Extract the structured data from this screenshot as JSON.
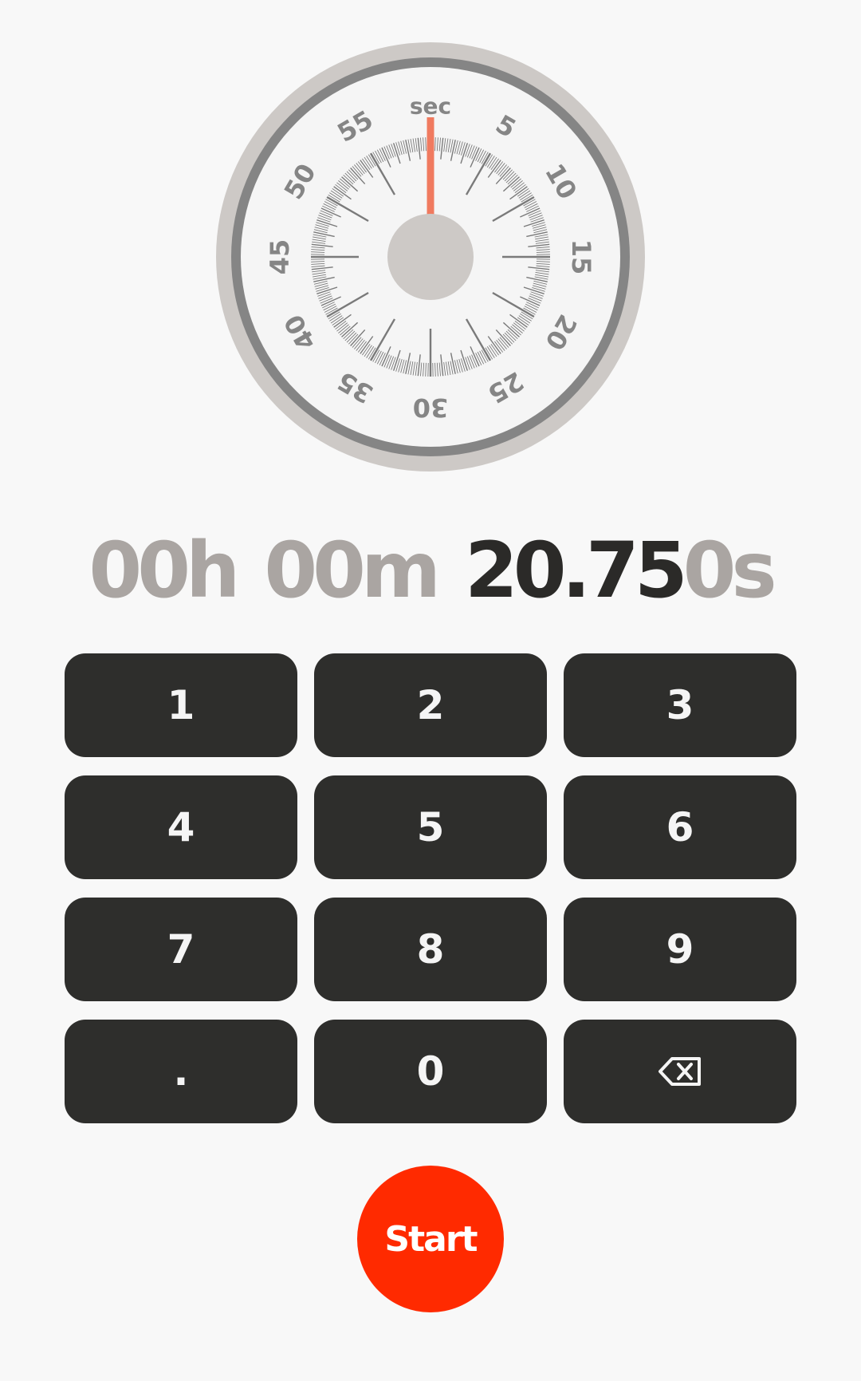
{
  "dial": {
    "unit_label": "sec",
    "numbers": [
      "5",
      "10",
      "15",
      "20",
      "25",
      "30",
      "35",
      "40",
      "45",
      "50",
      "55"
    ],
    "hand_value_seconds": 0,
    "colors": {
      "outer_ring": "#cdc9c6",
      "bezel": "#858585",
      "face": "#f5f5f5",
      "ticks": "#7a7a7a",
      "numbers": "#858585",
      "hub": "#cdc9c6",
      "hand": "#f07a5f"
    }
  },
  "readout": {
    "hours": "00",
    "hours_unit": "h",
    "minutes": "00",
    "minutes_unit": "m",
    "seconds_entered": "20.75",
    "seconds_pending": "0",
    "seconds_unit": "s"
  },
  "keypad": {
    "keys": [
      "1",
      "2",
      "3",
      "4",
      "5",
      "6",
      "7",
      "8",
      "9",
      ".",
      "0"
    ],
    "backspace_icon": "backspace-icon"
  },
  "start": {
    "label": "Start",
    "color": "#ff2a00"
  }
}
